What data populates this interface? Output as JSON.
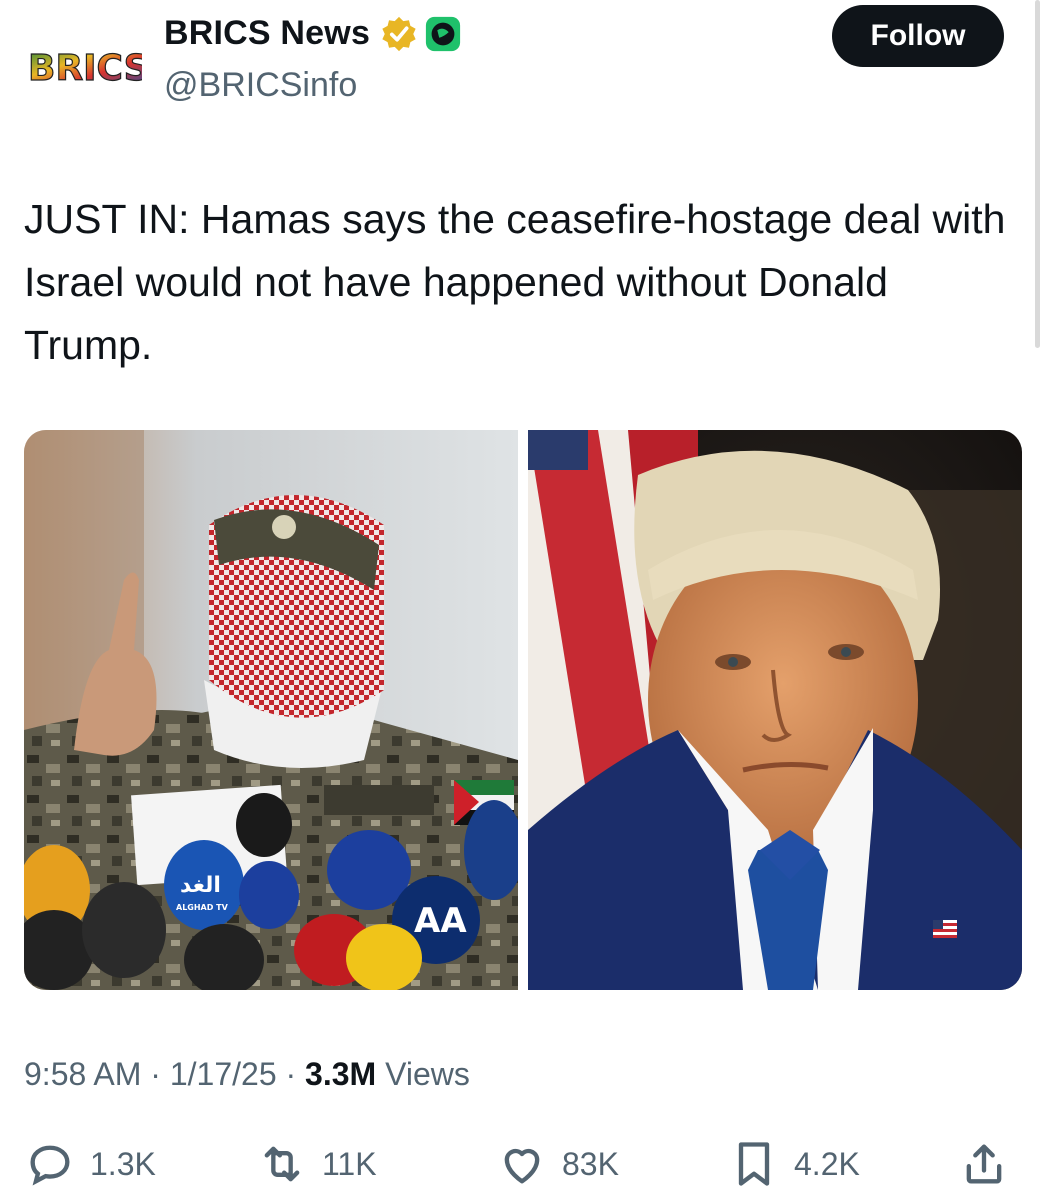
{
  "author": {
    "avatar_text": "BRICS",
    "display_name": "BRICS News",
    "handle": "@BRICSinfo"
  },
  "follow_label": "Follow",
  "tweet": {
    "text": "JUST IN: Hamas says the ceasefire-hostage deal with Israel would not have happened without Donald Trump."
  },
  "media": {
    "left_image": {
      "label_badge": "AA",
      "label_mic": "ALGHAD TV"
    },
    "right_image": {}
  },
  "meta": {
    "time": "9:58 AM",
    "date": "1/17/25",
    "views_count": "3.3M",
    "views_label": "Views"
  },
  "actions": {
    "replies": "1.3K",
    "reposts": "11K",
    "likes": "83K",
    "bookmarks": "4.2K"
  },
  "colors": {
    "text": "#0f1419",
    "secondary": "#536471",
    "verified_gold": "#e8b625",
    "affiliate_green": "#1fc16b"
  }
}
